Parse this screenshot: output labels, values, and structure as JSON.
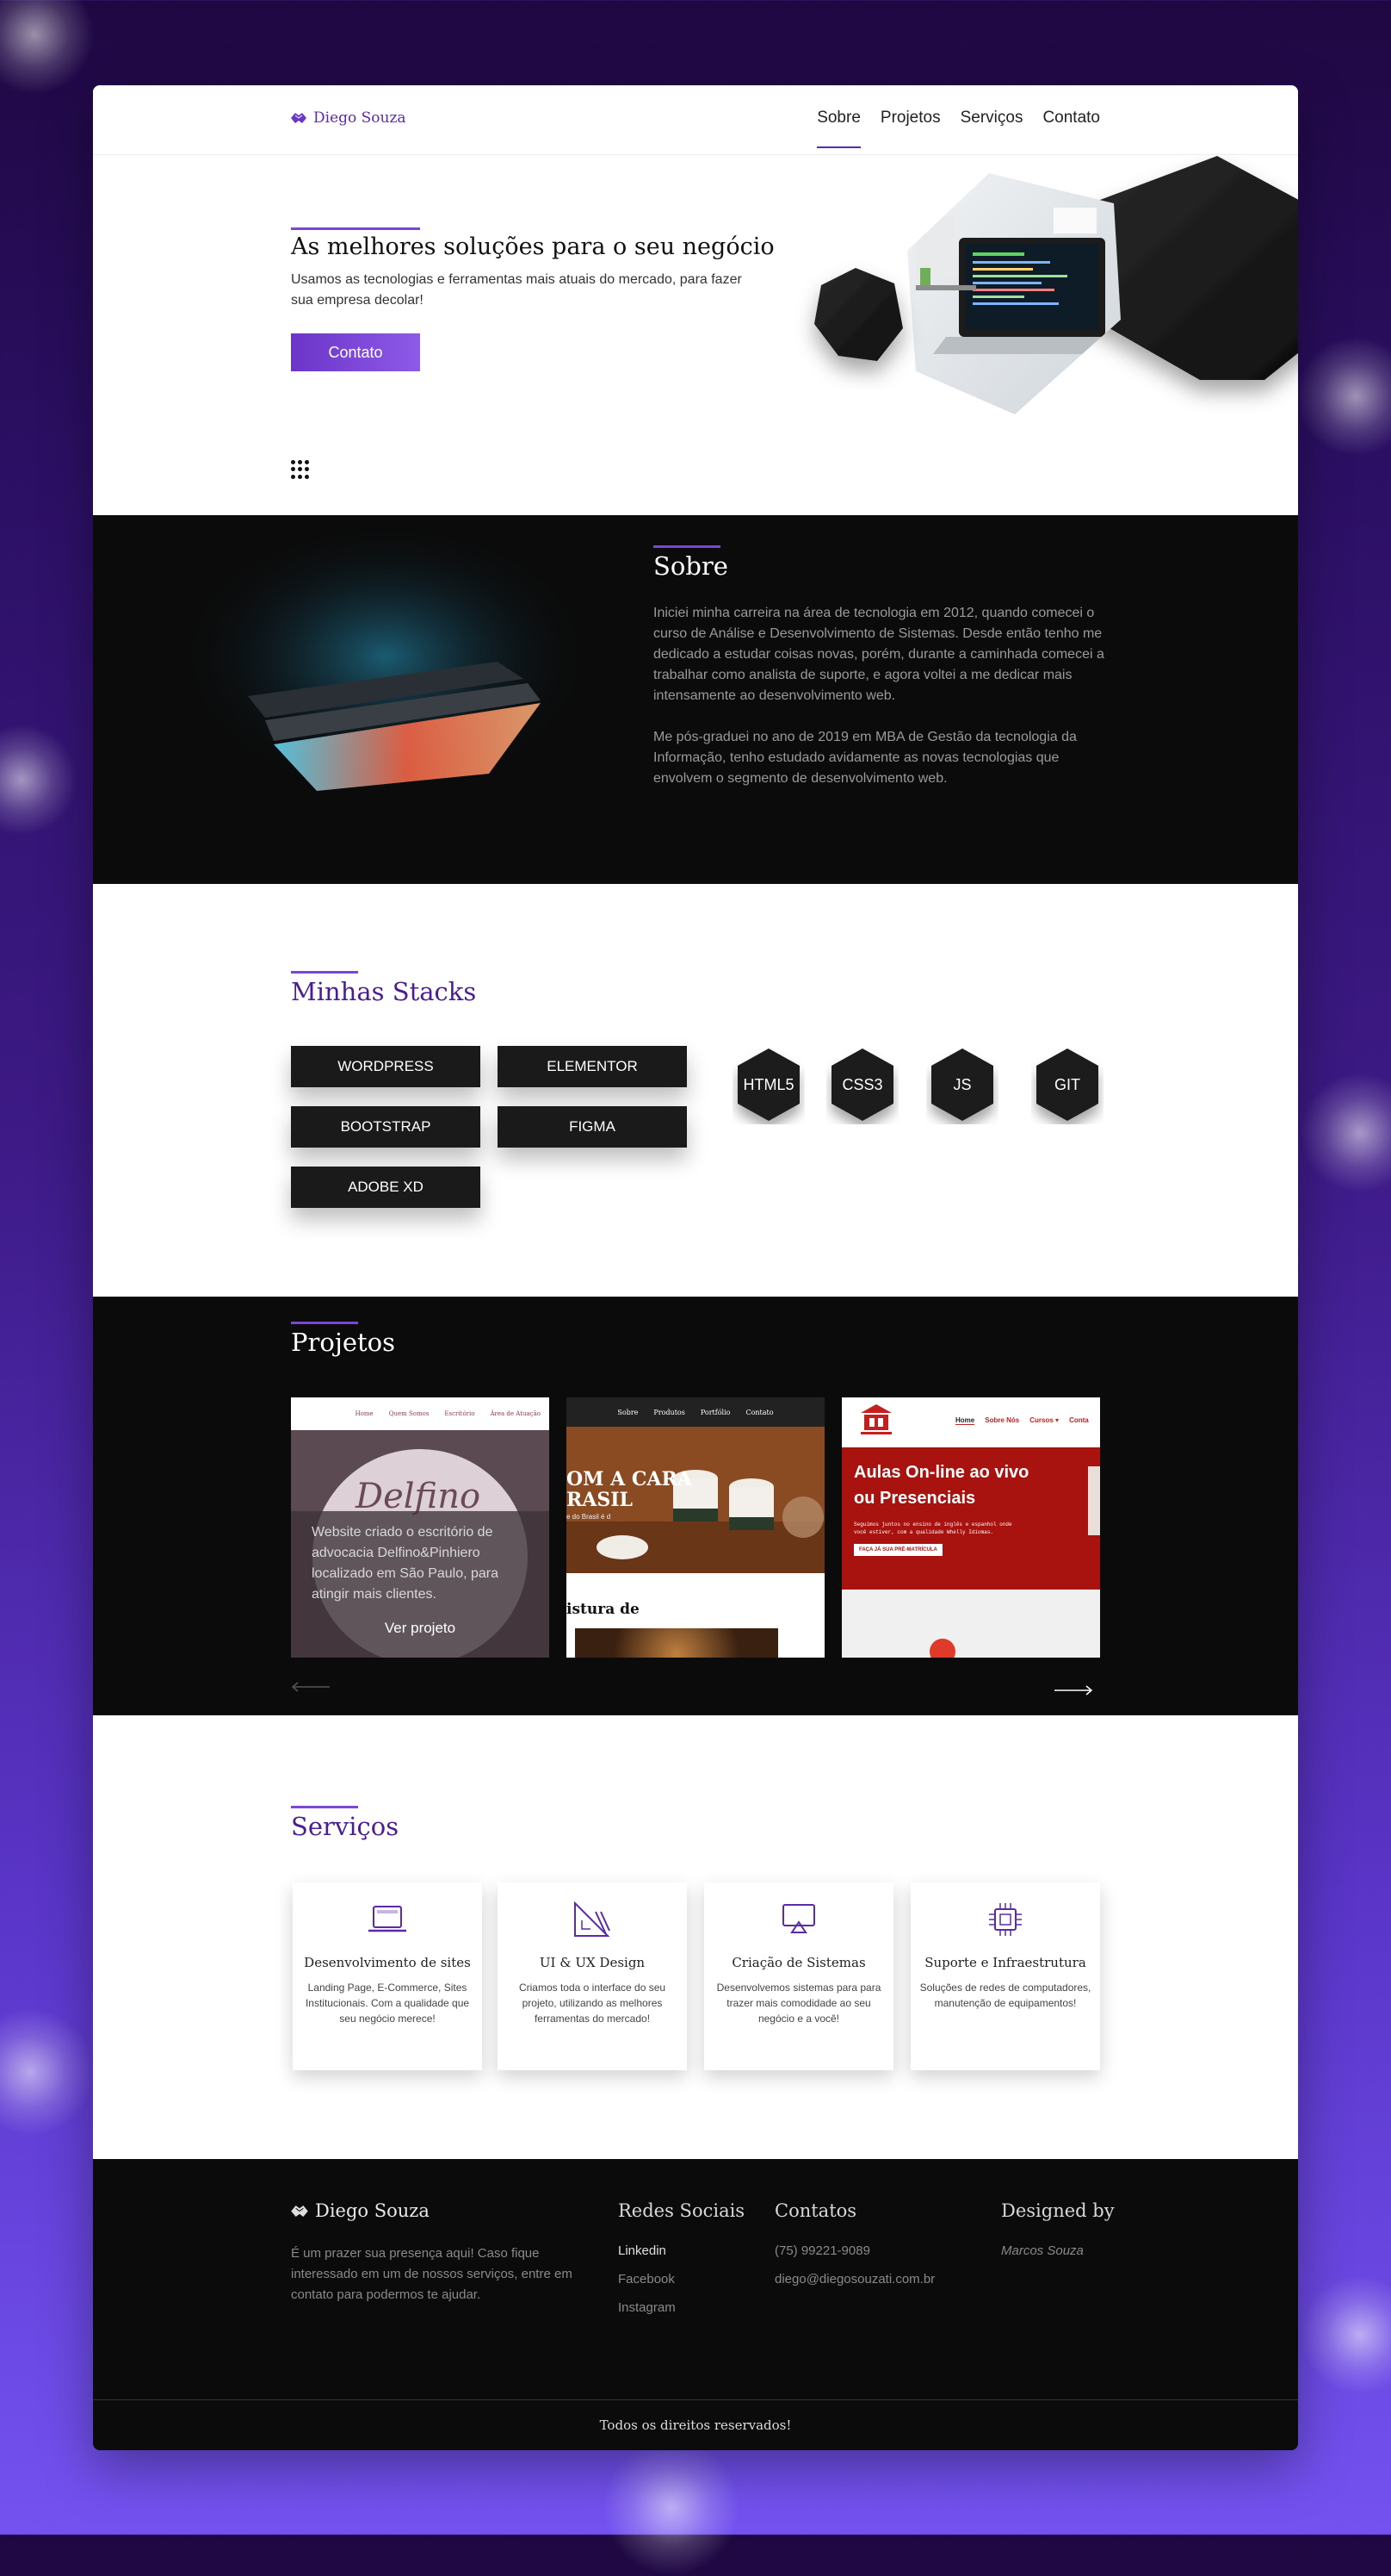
{
  "brand": {
    "name": "Diego Souza",
    "accent": "#6b35c8",
    "dark": "#0b0b0b"
  },
  "nav": {
    "links": [
      "Sobre",
      "Projetos",
      "Serviços",
      "Contato"
    ],
    "active": "Sobre"
  },
  "hero": {
    "title": "As melhores soluções para o seu negócio",
    "subtitle": "Usamos as tecnologias e ferramentas mais atuais do mercado, para fazer sua empresa decolar!",
    "button": "Contato"
  },
  "sobre": {
    "title": "Sobre",
    "paragraphs": [
      "Iniciei minha carreira na área de tecnologia em 2012, quando comecei o curso de Análise e Desenvolvimento de Sistemas. Desde então tenho me dedicado a estudar coisas novas, porém, durante a caminhada comecei a trabalhar como analista de suporte, e agora voltei a me dedicar mais intensamente ao desenvolvimento web.",
      "Me pós-graduei no ano de 2019 em MBA de Gestão da tecnologia da Informação, tenho estudado avidamente as novas tecnologias que envolvem o segmento de desenvolvimento web."
    ]
  },
  "stacks": {
    "title": "Minhas Stacks",
    "tools": [
      "WORDPRESS",
      "ELEMENTOR",
      "BOOTSTRAP",
      "FIGMA",
      "ADOBE XD"
    ],
    "languages": [
      "HTML5",
      "CSS3",
      "JS",
      "GIT"
    ]
  },
  "projetos": {
    "title": "Projetos",
    "cards": [
      {
        "nav": [
          "Home",
          "Quem Somos",
          "Escritório",
          "Área de Atuação"
        ],
        "logo_text": "Delfino",
        "overlay_text": "Website criado o escritório de advocacia Delfino&Pinhiero localizado em São Paulo, para atingir mais clientes.",
        "cta": "Ver projeto"
      },
      {
        "nav": [
          "Sobre",
          "Produtos",
          "Portfólio",
          "Contato"
        ],
        "hero_text_1": "OM A CARA",
        "hero_text_2": "RASIL",
        "hero_caption": "e do Brasil é d",
        "section_text": "istura de"
      },
      {
        "nav": [
          "Home",
          "Sobre Nós",
          "Cursos ▾",
          "Conta"
        ],
        "headline_1": "Aulas On-line ao vivo",
        "headline_2": "ou Presenciais",
        "body_1": "Seguimos juntos no ensino de inglês e espanhol onde",
        "body_2": "você estiver, com a qualidade Whelly Idiomas.",
        "cta": "FAÇA JÁ SUA PRÉ-MATRÍCULA"
      }
    ]
  },
  "servicos": {
    "title": "Serviços",
    "items": [
      {
        "icon": "laptop-icon",
        "name": "Desenvolvimento de sites",
        "desc": "Landing Page, E-Commerce, Sites Institucionais. Com a qualidade que seu negócio merece!"
      },
      {
        "icon": "ruler-triangle-icon",
        "name": "UI & UX Design",
        "desc": "Criamos toda o interface do seu projeto, utilizando as melhores ferramentas do mercado!"
      },
      {
        "icon": "monitor-icon",
        "name": "Criação de Sistemas",
        "desc": "Desenvolvemos sistemas para para trazer mais comodidade ao seu negócio e a você!"
      },
      {
        "icon": "chip-icon",
        "name": "Suporte e Infraestrutura",
        "desc": "Soluções de redes de computadores, manutenção de equipamentos!"
      }
    ]
  },
  "footer": {
    "brand": "Diego Souza",
    "text": "É um prazer sua presença aqui! Caso fique interessado em um de nossos serviços, entre em contato para podermos te ajudar.",
    "social_title": "Redes Sociais",
    "social_links": [
      "Linkedin",
      "Facebook",
      "Instagram"
    ],
    "contact_title": "Contatos",
    "phone": "(75) 99221-9089",
    "email": "diego@diegosouzati.com.br",
    "designed_title": "Designed by",
    "designer": "Marcos Souza",
    "copyright": "Todos os direitos reservados!"
  }
}
